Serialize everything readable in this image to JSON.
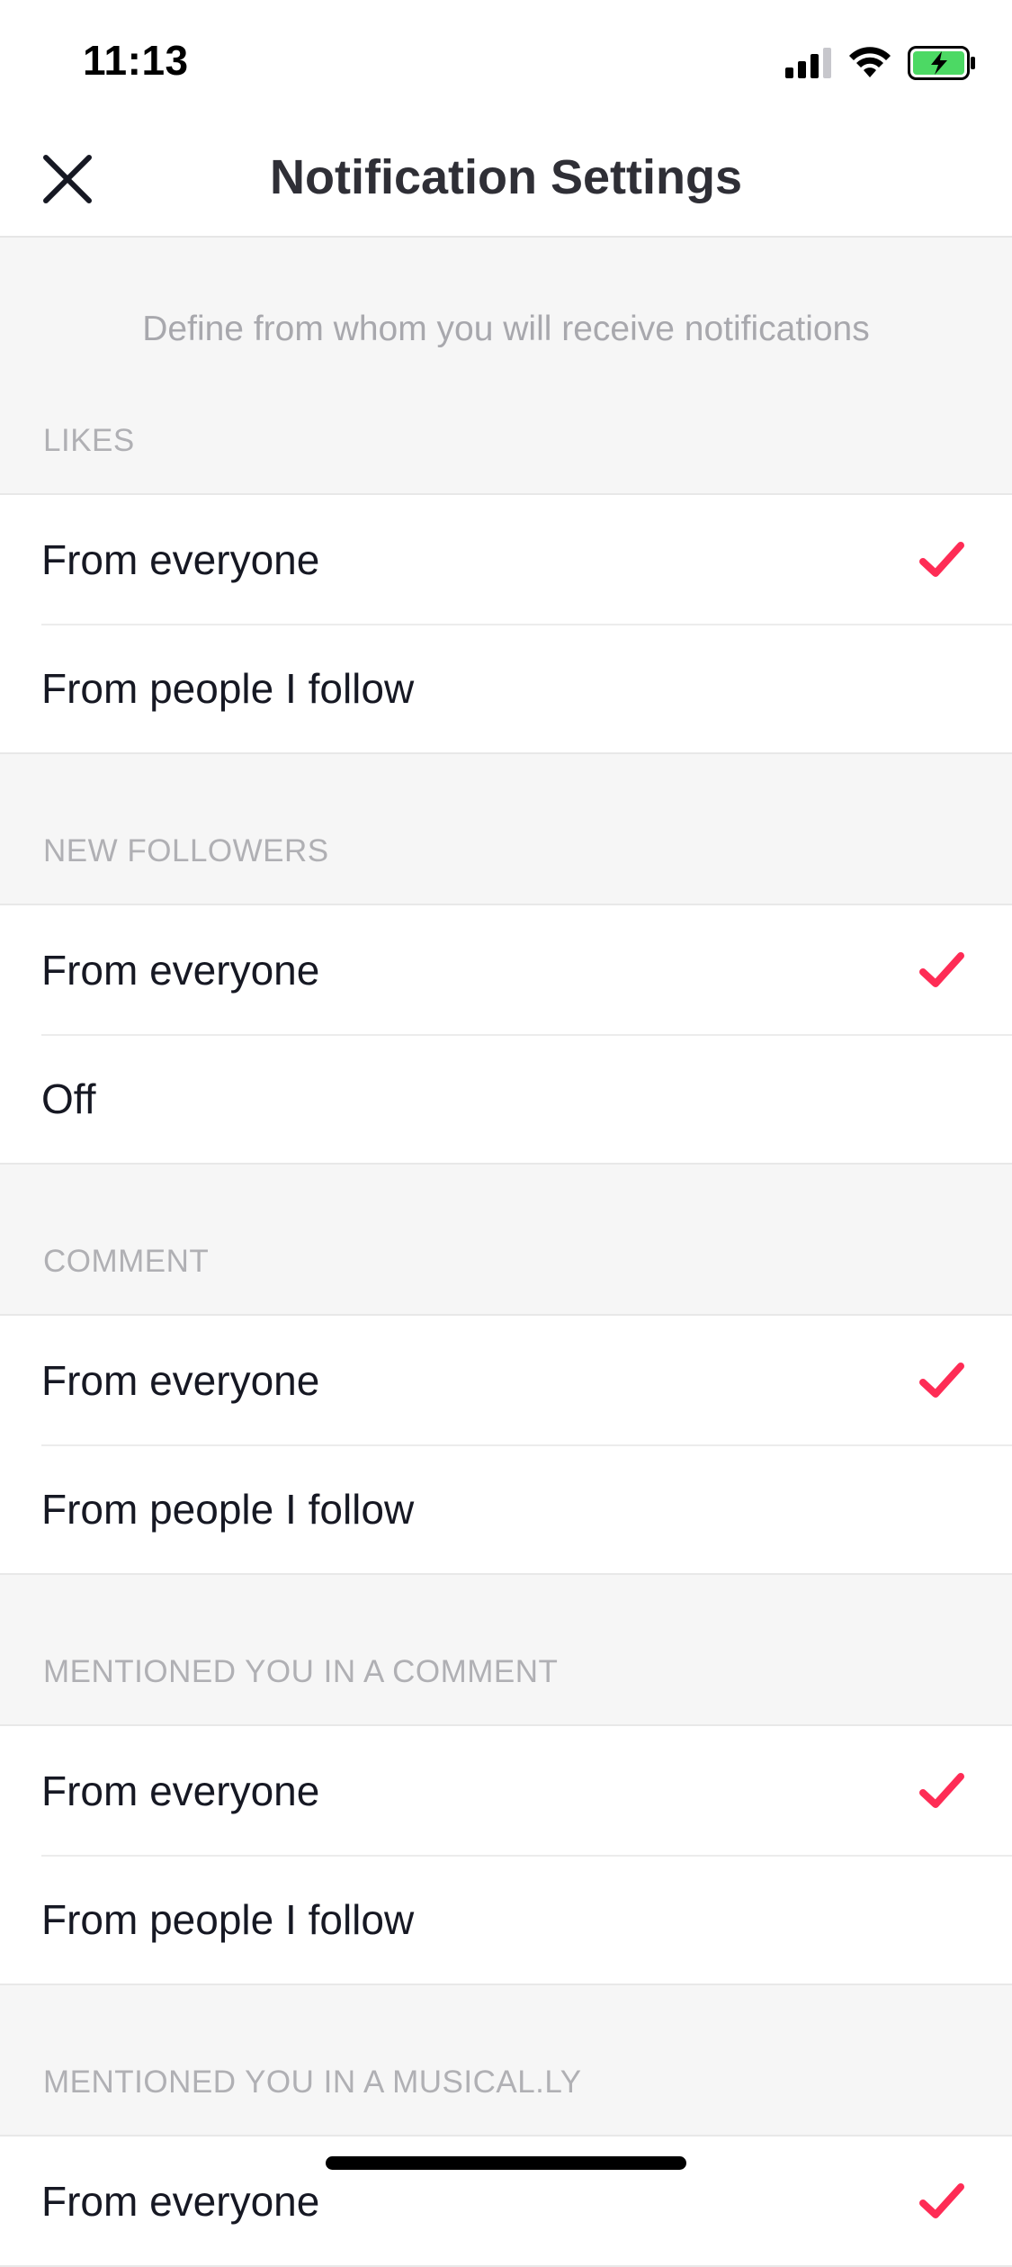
{
  "status": {
    "time": "11:13"
  },
  "header": {
    "title": "Notification Settings",
    "close_icon": "close-icon"
  },
  "description": "Define from whom you will receive notifications",
  "accent_color": "#fe2c55",
  "sections": [
    {
      "title": "LIKES",
      "options": [
        {
          "label": "From everyone",
          "selected": true
        },
        {
          "label": "From people I follow",
          "selected": false
        }
      ]
    },
    {
      "title": "NEW FOLLOWERS",
      "options": [
        {
          "label": "From everyone",
          "selected": true
        },
        {
          "label": "Off",
          "selected": false
        }
      ]
    },
    {
      "title": "COMMENT",
      "options": [
        {
          "label": "From everyone",
          "selected": true
        },
        {
          "label": "From people I follow",
          "selected": false
        }
      ]
    },
    {
      "title": "MENTIONED YOU IN A COMMENT",
      "options": [
        {
          "label": "From everyone",
          "selected": true
        },
        {
          "label": "From people I follow",
          "selected": false
        }
      ]
    },
    {
      "title": "MENTIONED YOU IN A MUSICAL.LY",
      "options": [
        {
          "label": "From everyone",
          "selected": true
        }
      ]
    }
  ]
}
